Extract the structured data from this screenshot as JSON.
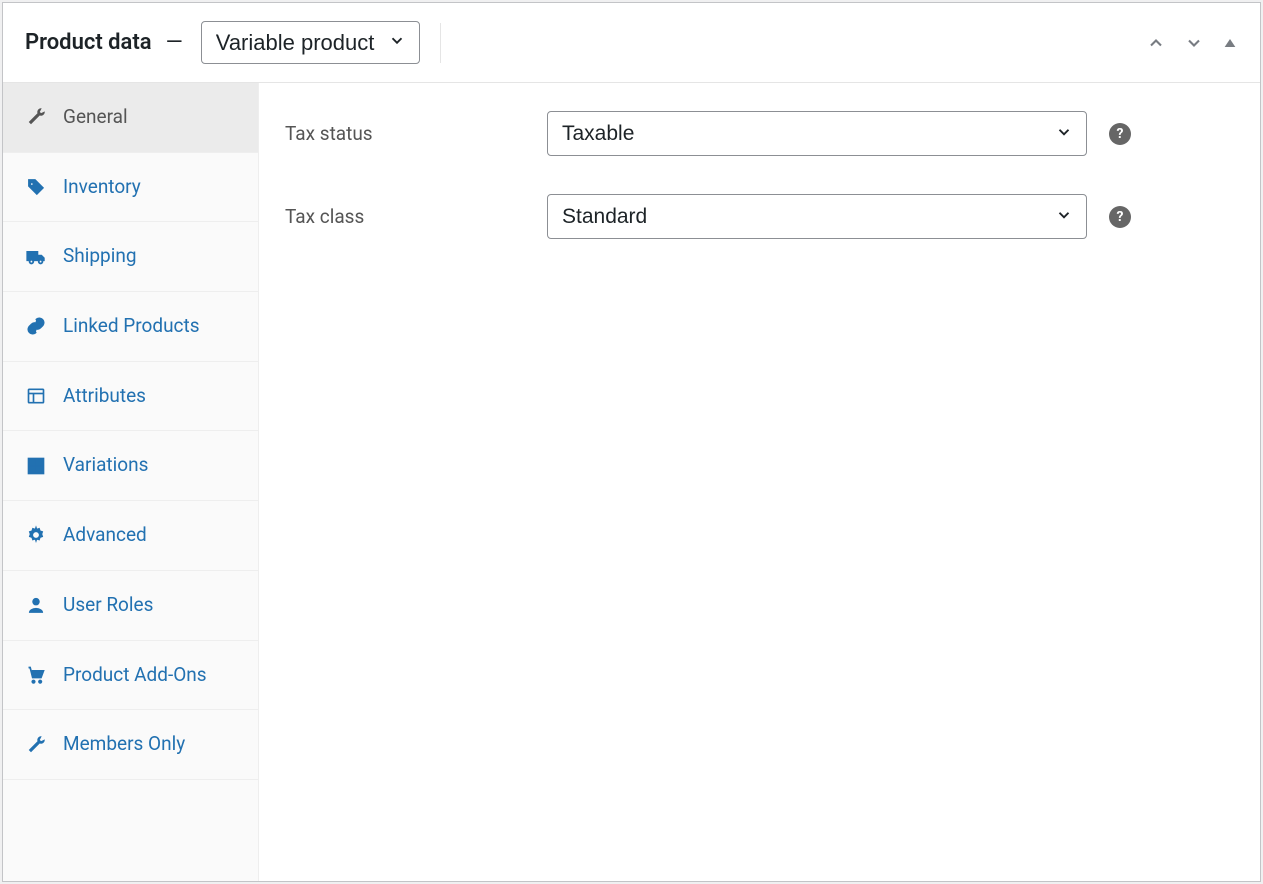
{
  "header": {
    "title": "Product data",
    "dash": "—",
    "product_type": "Variable product"
  },
  "sidebar": {
    "items": [
      {
        "label": "General",
        "icon": "wrench",
        "active": true
      },
      {
        "label": "Inventory",
        "icon": "tag",
        "active": false
      },
      {
        "label": "Shipping",
        "icon": "truck",
        "active": false
      },
      {
        "label": "Linked Products",
        "icon": "link",
        "active": false
      },
      {
        "label": "Attributes",
        "icon": "list",
        "active": false
      },
      {
        "label": "Variations",
        "icon": "grid",
        "active": false
      },
      {
        "label": "Advanced",
        "icon": "gear",
        "active": false
      },
      {
        "label": "User Roles",
        "icon": "user",
        "active": false
      },
      {
        "label": "Product Add-Ons",
        "icon": "cart",
        "active": false
      },
      {
        "label": "Members Only",
        "icon": "wrench",
        "active": false
      }
    ]
  },
  "main": {
    "tax_status": {
      "label": "Tax status",
      "value": "Taxable"
    },
    "tax_class": {
      "label": "Tax class",
      "value": "Standard"
    }
  }
}
